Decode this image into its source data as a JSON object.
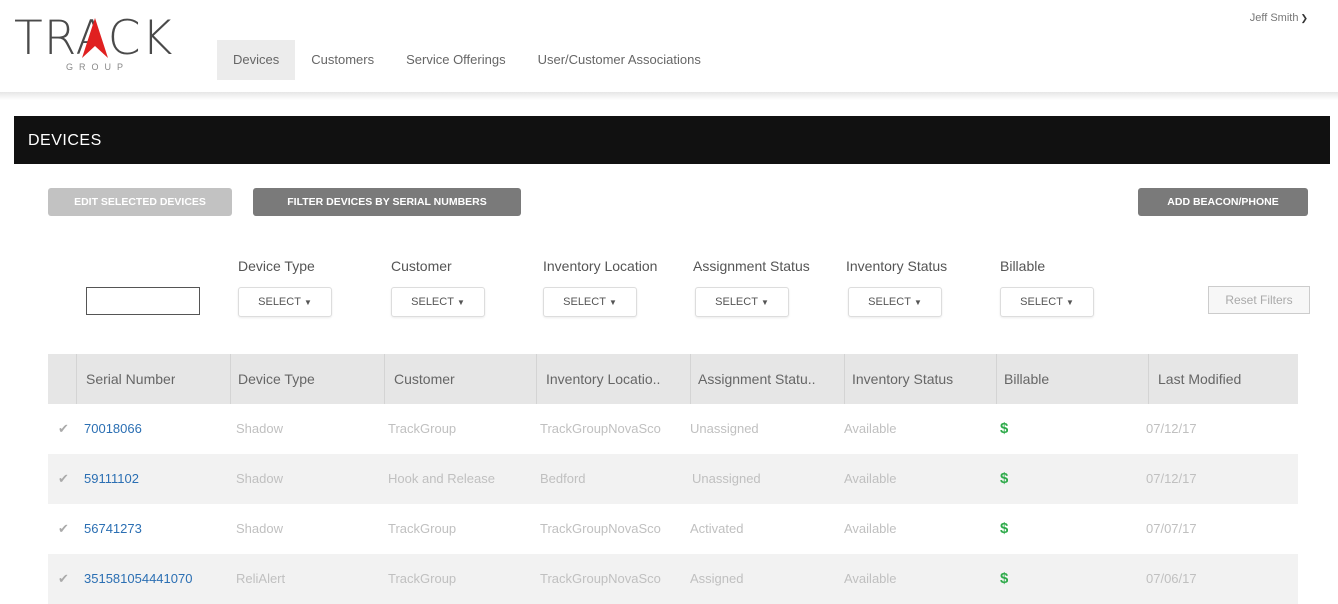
{
  "logo": {
    "main": "TRACK",
    "sub": "GROUP"
  },
  "nav": [
    {
      "label": "Devices"
    },
    {
      "label": "Customers"
    },
    {
      "label": "Service Offerings"
    },
    {
      "label": "User/Customer Associations"
    }
  ],
  "user": {
    "name": "Jeff Smith",
    "icon": "chevron-down-icon"
  },
  "page": {
    "title": "DEVICES"
  },
  "buttons": {
    "edit": "EDIT SELECTED DEVICES",
    "filter": "FILTER DEVICES BY SERIAL NUMBERS",
    "add": "ADD BEACON/PHONE",
    "reset": "Reset Filters"
  },
  "filters": {
    "serial_value": "",
    "labels": [
      "Device Type",
      "Customer",
      "Inventory Location",
      "Assignment Status",
      "Inventory Status",
      "Billable"
    ],
    "select_label": "SELECT"
  },
  "table": {
    "headers": [
      "Serial Number",
      "Device Type",
      "Customer",
      "Inventory Locatio..",
      "Assignment Statu..",
      "Inventory Status",
      "Billable",
      "Last Modified"
    ],
    "rows": [
      [
        "70018066",
        "Shadow",
        "TrackGroup",
        "TrackGroupNovaSco",
        "Unassigned",
        "Available",
        "$",
        "07/12/17"
      ],
      [
        "59111102",
        "Shadow",
        "Hook and Release",
        "Bedford",
        "Unassigned",
        "Available",
        "$",
        "07/12/17"
      ],
      [
        "56741273",
        "Shadow",
        "TrackGroup",
        "TrackGroupNovaSco",
        "Activated",
        "Available",
        "$",
        "07/07/17"
      ],
      [
        "351581054441070",
        "ReliAlert",
        "TrackGroup",
        "TrackGroupNovaSco",
        "Assigned",
        "Available",
        "$",
        "07/06/17"
      ]
    ]
  },
  "colors": {
    "accent_red": "#e02020",
    "title_bar": "#111111",
    "link": "#2b6fb3",
    "billable": "#2eaa4a"
  }
}
